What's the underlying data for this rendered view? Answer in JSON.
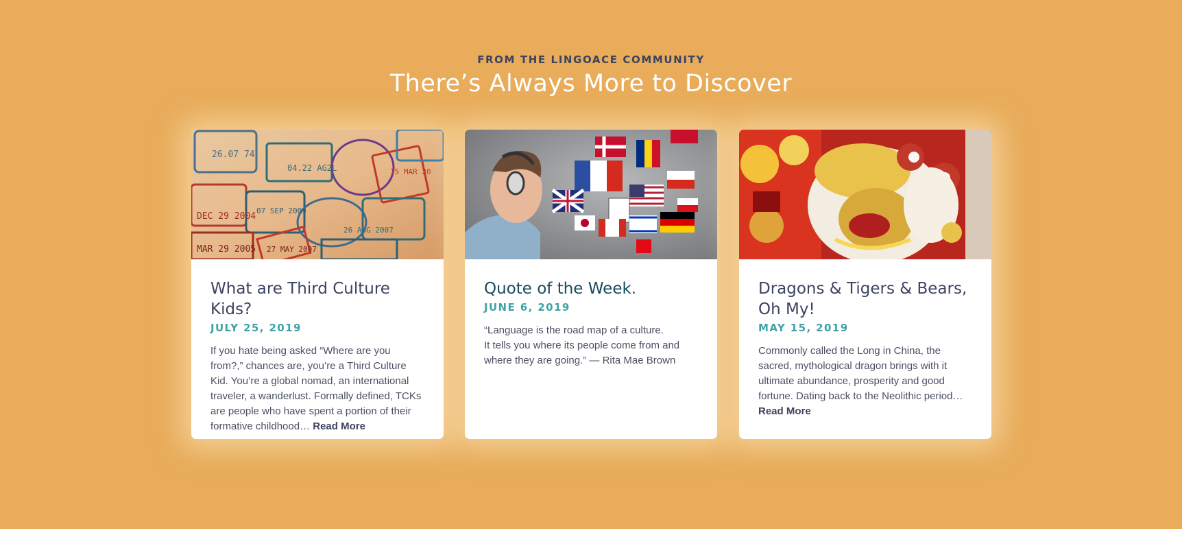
{
  "section": {
    "eyebrow": "FROM THE LINGOACE COMMUNITY",
    "headline": "There’s Always More to Discover"
  },
  "posts": [
    {
      "title": "What are Third Culture Kids?",
      "date": "JULY 25, 2019",
      "excerpt": "If you hate being asked “Where are you from?,” chances are, you’re a Third Culture Kid. You’re a global nomad, an international traveler, a wanderlust. Formally defined, TCKs are people who have spent a portion of their formative childhood…",
      "read_more": "Read More",
      "image": "passport-stamps-image"
    },
    {
      "title": "Quote of the Week.",
      "date": "JUNE 6, 2019",
      "quote_line1": "“Language is the road map of a culture.",
      "quote_line2": "It tells you where its people come from and where they are going.”  —  Rita Mae Brown",
      "image": "boy-headphones-flags-image"
    },
    {
      "title": "Dragons & Tigers & Bears, Oh My!",
      "date": "MAY 15, 2019",
      "excerpt": "Commonly called the Long in China, the sacred, mythological dragon brings with it ultimate abundance, prosperity and good fortune. Dating back to the Neolithic period…",
      "read_more": "Read More",
      "image": "lion-dance-image"
    }
  ],
  "colors": {
    "background": "#e8ac5a",
    "heading_dark": "#3e4360",
    "date_teal": "#3fa3a6",
    "card": "#ffffff"
  }
}
